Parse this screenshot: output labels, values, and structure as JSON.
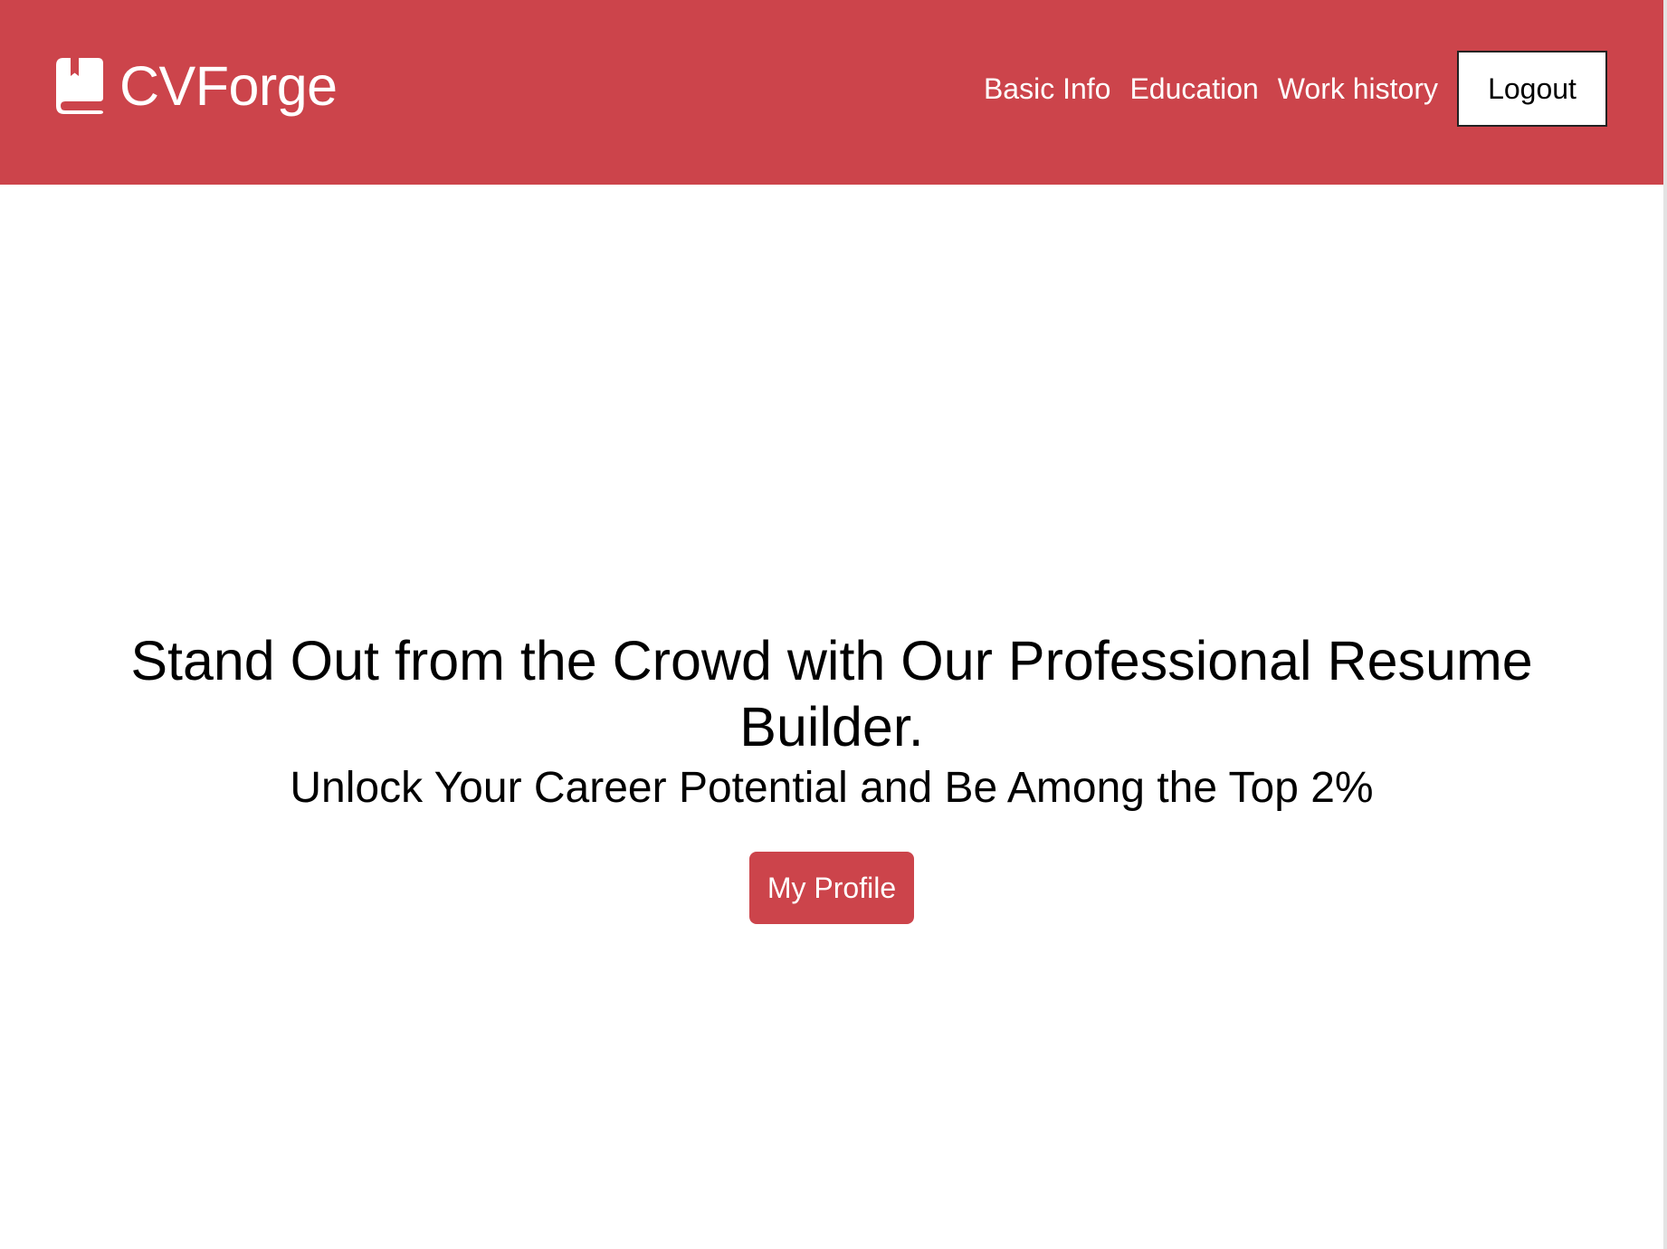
{
  "colors": {
    "brand": "#cc444b",
    "header_text": "#ffffff",
    "body_text": "#000000",
    "background": "#ffffff"
  },
  "header": {
    "brand_icon": "book-bookmark-icon",
    "brand_name": "CVForge",
    "nav": [
      {
        "label": "Basic Info"
      },
      {
        "label": "Education"
      },
      {
        "label": "Work history"
      }
    ],
    "logout_label": "Logout"
  },
  "hero": {
    "title": "Stand Out from the Crowd with Our Professional Resume Builder.",
    "subtitle": "Unlock Your Career Potential and Be Among the Top 2%",
    "cta_label": "My Profile"
  }
}
